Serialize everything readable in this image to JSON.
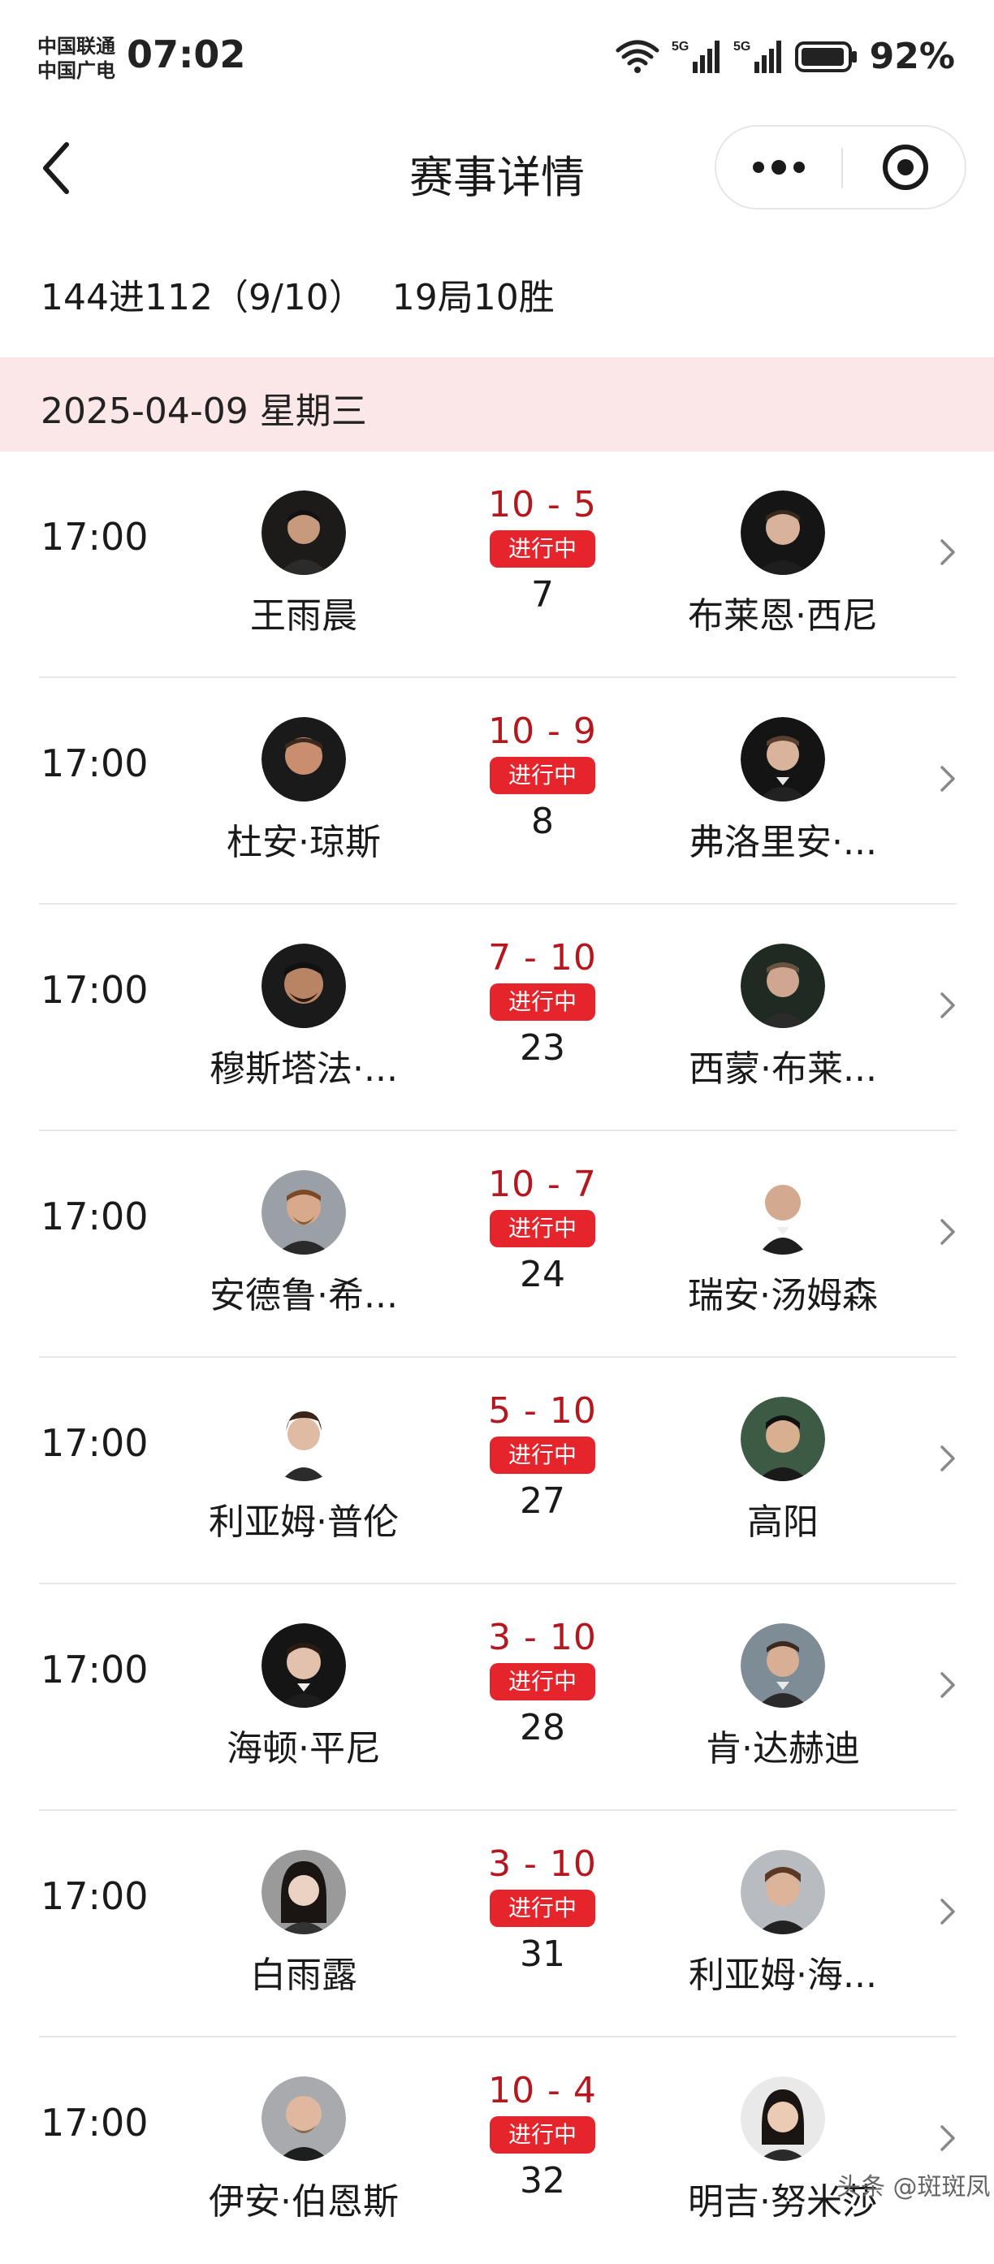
{
  "status_bar": {
    "carrier_1": "中国联通",
    "carrier_2": "中国广电",
    "time": "07:02",
    "signal_1_label": "5G",
    "signal_2_label": "5G",
    "battery": "92%"
  },
  "nav": {
    "title": "赛事详情",
    "more_icon": "more-dots-icon",
    "close_icon": "target-circle-icon"
  },
  "round": {
    "name": "144进112（9/10）",
    "format": "19局10胜"
  },
  "date_header": "2025-04-09 星期三",
  "colors": {
    "accent_red": "#e6242c",
    "score_red": "#b5171f",
    "date_band": "#fbe6e8"
  },
  "matches": [
    {
      "time": "17:00",
      "player1": "王雨晨",
      "score": "10 - 5",
      "status": "进行中",
      "frame": "7",
      "player2": "布莱恩·西尼"
    },
    {
      "time": "17:00",
      "player1": "杜安·琼斯",
      "score": "10 - 9",
      "status": "进行中",
      "frame": "8",
      "player2": "弗洛里安·..."
    },
    {
      "time": "17:00",
      "player1": "穆斯塔法·...",
      "score": "7 - 10",
      "status": "进行中",
      "frame": "23",
      "player2": "西蒙·布莱..."
    },
    {
      "time": "17:00",
      "player1": "安德鲁·希...",
      "score": "10 - 7",
      "status": "进行中",
      "frame": "24",
      "player2": "瑞安·汤姆森"
    },
    {
      "time": "17:00",
      "player1": "利亚姆·普伦",
      "score": "5 - 10",
      "status": "进行中",
      "frame": "27",
      "player2": "高阳"
    },
    {
      "time": "17:00",
      "player1": "海顿·平尼",
      "score": "3 - 10",
      "status": "进行中",
      "frame": "28",
      "player2": "肯·达赫迪"
    },
    {
      "time": "17:00",
      "player1": "白雨露",
      "score": "3 - 10",
      "status": "进行中",
      "frame": "31",
      "player2": "利亚姆·海..."
    },
    {
      "time": "17:00",
      "player1": "伊安·伯恩斯",
      "score": "10 - 4",
      "status": "进行中",
      "frame": "32",
      "player2": "明吉·努米莎"
    }
  ],
  "watermark": "头条 @斑斑凤"
}
